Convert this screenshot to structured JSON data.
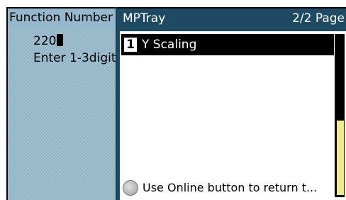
{
  "background_panel": {
    "header": "Function Number",
    "value": "220",
    "instruction": "Enter 1-3digit"
  },
  "window": {
    "title": "MPTray",
    "page_indicator": "2/2 Page",
    "items": [
      {
        "number": "1",
        "label": "Y Scaling"
      }
    ],
    "hint": {
      "icon": "online-button-icon",
      "text": "Use Online button to return t..."
    },
    "scroll": {
      "thumb_start": 0.53,
      "thumb_end": 1.0
    }
  },
  "colors": {
    "titlebar": "#1f4a63",
    "selected_bg": "#000000",
    "scroll_thumb": "#f1ea8d",
    "panel_bg": "#a3c3d6"
  }
}
